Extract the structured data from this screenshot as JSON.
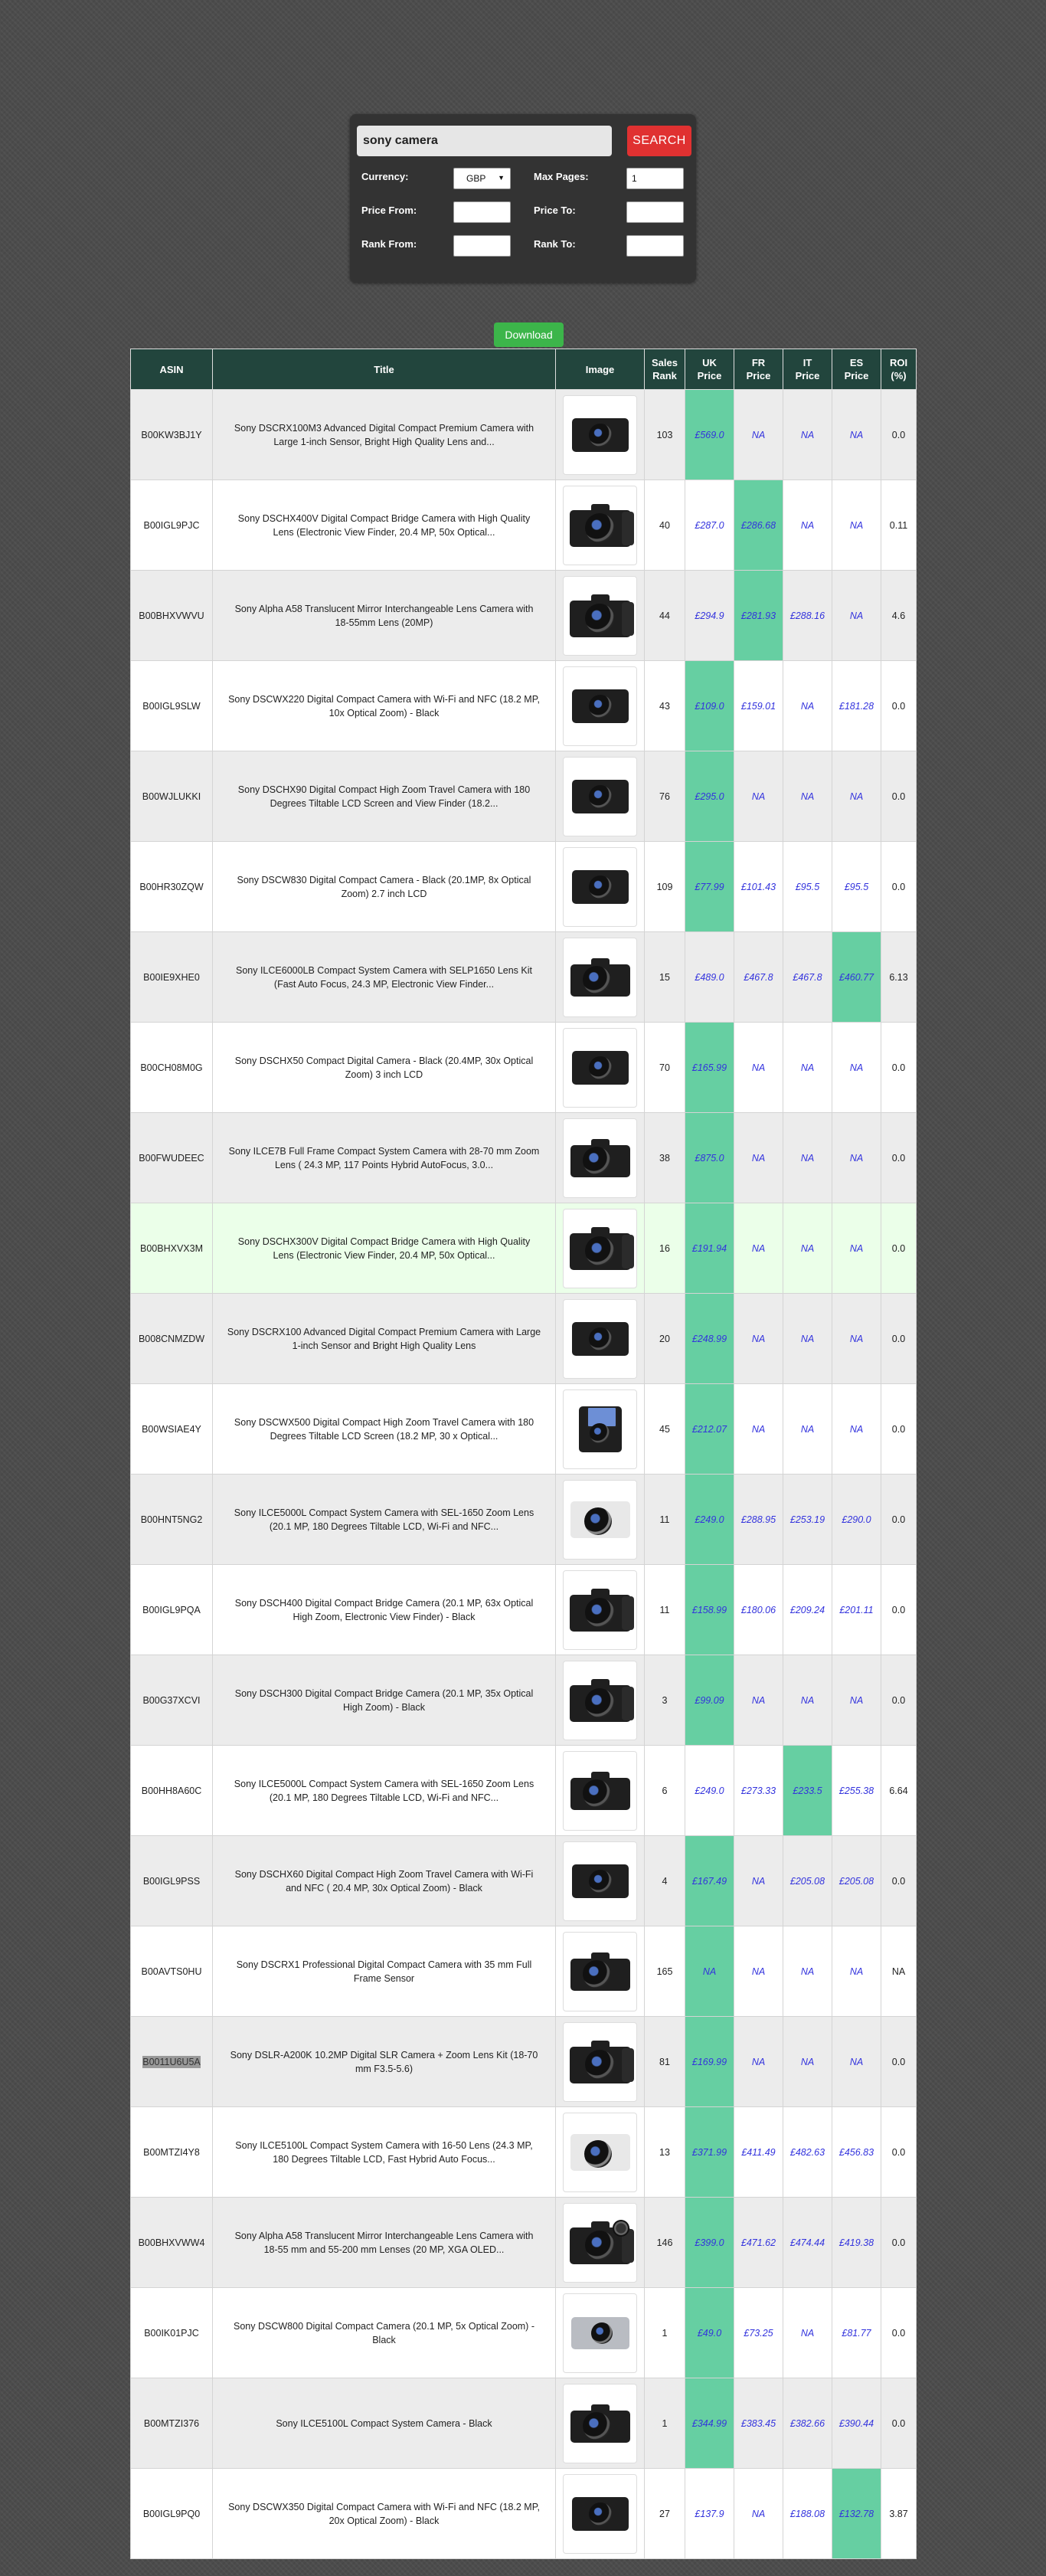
{
  "search": {
    "query": "sony camera",
    "button_label": "SEARCH",
    "currency_label": "Currency:",
    "currency_value": "GBP",
    "max_pages_label": "Max Pages:",
    "max_pages_value": "1",
    "price_from_label": "Price From:",
    "price_from_value": "",
    "price_to_label": "Price To:",
    "price_to_value": "",
    "rank_from_label": "Rank From:",
    "rank_from_value": "",
    "rank_to_label": "Rank To:",
    "rank_to_value": ""
  },
  "download_label": "Download",
  "table": {
    "headers": {
      "asin": "ASIN",
      "title": "Title",
      "image": "Image",
      "sales_rank_1": "Sales",
      "sales_rank_2": "Rank",
      "uk_1": "UK",
      "uk_2": "Price",
      "fr_1": "FR",
      "fr_2": "Price",
      "it_1": "IT",
      "it_2": "Price",
      "es_1": "ES",
      "es_2": "Price",
      "roi_1": "ROI",
      "roi_2": "(%)"
    },
    "highlight_color": "#66cfa2",
    "header_color": "#22453d",
    "rows": [
      {
        "asin": "B00KW3BJ1Y",
        "title": "Sony DSCRX100M3 Advanced Digital Compact Premium Camera with Large 1-inch Sensor, Bright High Quality Lens and...",
        "image": "compact-camera-icon",
        "rank": "103",
        "uk": "£569.0",
        "fr": "NA",
        "it": "NA",
        "es": "NA",
        "roi": "0.0",
        "best": "uk"
      },
      {
        "asin": "B00IGL9PJC",
        "title": "Sony DSCHX400V Digital Compact Bridge Camera with High Quality Lens (Electronic View Finder, 20.4 MP, 50x Optical...",
        "image": "bridge-camera-icon",
        "rank": "40",
        "uk": "£287.0",
        "fr": "£286.68",
        "it": "NA",
        "es": "NA",
        "roi": "0.11",
        "best": "fr"
      },
      {
        "asin": "B00BHXVWVU",
        "title": "Sony Alpha A58 Translucent Mirror Interchangeable Lens Camera with 18-55mm Lens (20MP)",
        "image": "dslr-camera-icon",
        "rank": "44",
        "uk": "£294.9",
        "fr": "£281.93",
        "it": "£288.16",
        "es": "NA",
        "roi": "4.6",
        "best": "fr"
      },
      {
        "asin": "B00IGL9SLW",
        "title": "Sony DSCWX220 Digital Compact Camera with Wi-Fi and NFC (18.2 MP, 10x Optical Zoom) - Black",
        "image": "compact-camera-icon",
        "rank": "43",
        "uk": "£109.0",
        "fr": "£159.01",
        "it": "NA",
        "es": "£181.28",
        "roi": "0.0",
        "best": "uk"
      },
      {
        "asin": "B00WJLUKKI",
        "title": "Sony DSCHX90 Digital Compact High Zoom Travel Camera with 180 Degrees Tiltable LCD Screen and View Finder (18.2...",
        "image": "compact-camera-icon",
        "rank": "76",
        "uk": "£295.0",
        "fr": "NA",
        "it": "NA",
        "es": "NA",
        "roi": "0.0",
        "best": "uk"
      },
      {
        "asin": "B00HR30ZQW",
        "title": "Sony DSCW830 Digital Compact Camera - Black (20.1MP, 8x Optical Zoom) 2.7 inch LCD",
        "image": "compact-camera-icon",
        "rank": "109",
        "uk": "£77.99",
        "fr": "£101.43",
        "it": "£95.5",
        "es": "£95.5",
        "roi": "0.0",
        "best": "uk"
      },
      {
        "asin": "B00IE9XHE0",
        "title": "Sony ILCE6000LB Compact System Camera with SELP1650 Lens Kit (Fast Auto Focus, 24.3 MP, Electronic View Finder...",
        "image": "system-camera-icon",
        "rank": "15",
        "uk": "£489.0",
        "fr": "£467.8",
        "it": "£467.8",
        "es": "£460.77",
        "roi": "6.13",
        "best": "es"
      },
      {
        "asin": "B00CH08M0G",
        "title": "Sony DSCHX50 Compact Digital Camera - Black (20.4MP, 30x Optical Zoom) 3 inch LCD",
        "image": "compact-camera-icon",
        "rank": "70",
        "uk": "£165.99",
        "fr": "NA",
        "it": "NA",
        "es": "NA",
        "roi": "0.0",
        "best": "uk"
      },
      {
        "asin": "B00FWUDEEC",
        "title": "Sony ILCE7B Full Frame Compact System Camera with 28-70 mm Zoom Lens ( 24.3 MP, 117 Points Hybrid AutoFocus, 3.0...",
        "image": "system-camera-icon",
        "rank": "38",
        "uk": "£875.0",
        "fr": "NA",
        "it": "NA",
        "es": "NA",
        "roi": "0.0",
        "best": "uk"
      },
      {
        "asin": "B00BHXVX3M",
        "title": "Sony DSCHX300V Digital Compact Bridge Camera with High Quality Lens (Electronic View Finder, 20.4 MP, 50x Optical...",
        "image": "bridge-camera-icon",
        "rank": "16",
        "uk": "£191.94",
        "fr": "NA",
        "it": "NA",
        "es": "NA",
        "roi": "0.0",
        "best": "uk",
        "highlight_row": true
      },
      {
        "asin": "B008CNMZDW",
        "title": "Sony DSCRX100 Advanced Digital Compact Premium Camera with Large 1-inch Sensor and Bright High Quality Lens",
        "image": "compact-camera-icon",
        "rank": "20",
        "uk": "£248.99",
        "fr": "NA",
        "it": "NA",
        "es": "NA",
        "roi": "0.0",
        "best": "uk"
      },
      {
        "asin": "B00WSIAE4Y",
        "title": "Sony DSCWX500 Digital Compact High Zoom Travel Camera with 180 Degrees Tiltable LCD Screen (18.2 MP, 30 x Optical...",
        "image": "tilt-screen-camera-icon",
        "rank": "45",
        "uk": "£212.07",
        "fr": "NA",
        "it": "NA",
        "es": "NA",
        "roi": "0.0",
        "best": "uk"
      },
      {
        "asin": "B00HNT5NG2",
        "title": "Sony ILCE5000L Compact System Camera with SEL-1650 Zoom Lens (20.1 MP, 180 Degrees Tiltable LCD, Wi-Fi and NFC...",
        "image": "white-system-camera-icon",
        "rank": "11",
        "uk": "£249.0",
        "fr": "£288.95",
        "it": "£253.19",
        "es": "£290.0",
        "roi": "0.0",
        "best": "uk"
      },
      {
        "asin": "B00IGL9PQA",
        "title": "Sony DSCH400 Digital Compact Bridge Camera (20.1 MP, 63x Optical High Zoom, Electronic View Finder) - Black",
        "image": "bridge-camera-icon",
        "rank": "11",
        "uk": "£158.99",
        "fr": "£180.06",
        "it": "£209.24",
        "es": "£201.11",
        "roi": "0.0",
        "best": "uk"
      },
      {
        "asin": "B00G37XCVI",
        "title": "Sony DSCH300 Digital Compact Bridge Camera (20.1 MP, 35x Optical High Zoom) - Black",
        "image": "bridge-camera-icon",
        "rank": "3",
        "uk": "£99.09",
        "fr": "NA",
        "it": "NA",
        "es": "NA",
        "roi": "0.0",
        "best": "uk"
      },
      {
        "asin": "B00HH8A60C",
        "title": "Sony ILCE5000L Compact System Camera with SEL-1650 Zoom Lens (20.1 MP, 180 Degrees Tiltable LCD, Wi-Fi and NFC...",
        "image": "system-camera-icon",
        "rank": "6",
        "uk": "£249.0",
        "fr": "£273.33",
        "it": "£233.5",
        "es": "£255.38",
        "roi": "6.64",
        "best": "it"
      },
      {
        "asin": "B00IGL9PSS",
        "title": "Sony DSCHX60 Digital Compact High Zoom Travel Camera with Wi-Fi and NFC ( 20.4 MP, 30x Optical Zoom) - Black",
        "image": "compact-camera-icon",
        "rank": "4",
        "uk": "£167.49",
        "fr": "NA",
        "it": "£205.08",
        "es": "£205.08",
        "roi": "0.0",
        "best": "uk"
      },
      {
        "asin": "B00AVTS0HU",
        "title": "Sony DSCRX1 Professional Digital Compact Camera with 35 mm Full Frame Sensor",
        "image": "system-camera-icon",
        "rank": "165",
        "uk": "NA",
        "fr": "NA",
        "it": "NA",
        "es": "NA",
        "roi": "NA",
        "best": "uk"
      },
      {
        "asin": "B0011U6U5A",
        "title": "Sony DSLR-A200K 10.2MP Digital SLR Camera + Zoom Lens Kit (18-70 mm F3.5-5.6)",
        "image": "dslr-camera-icon",
        "rank": "81",
        "uk": "£169.99",
        "fr": "NA",
        "it": "NA",
        "es": "NA",
        "roi": "0.0",
        "best": "uk",
        "asin_highlight": true
      },
      {
        "asin": "B00MTZI4Y8",
        "title": "Sony ILCE5100L Compact System Camera with 16-50 Lens (24.3 MP, 180 Degrees Tiltable LCD, Fast Hybrid Auto Focus...",
        "image": "white-system-camera-icon",
        "rank": "13",
        "uk": "£371.99",
        "fr": "£411.49",
        "it": "£482.63",
        "es": "£456.83",
        "roi": "0.0",
        "best": "uk"
      },
      {
        "asin": "B00BHXVWW4",
        "title": "Sony Alpha A58 Translucent Mirror Interchangeable Lens Camera with 18-55 mm and 55-200 mm Lenses (20 MP, XGA OLED...",
        "image": "dslr-kit-icon",
        "rank": "146",
        "uk": "£399.0",
        "fr": "£471.62",
        "it": "£474.44",
        "es": "£419.38",
        "roi": "0.0",
        "best": "uk"
      },
      {
        "asin": "B00IK01PJC",
        "title": "Sony DSCW800 Digital Compact Camera (20.1 MP, 5x Optical Zoom) - Black",
        "image": "silver-compact-camera-icon",
        "rank": "1",
        "uk": "£49.0",
        "fr": "£73.25",
        "it": "NA",
        "es": "£81.77",
        "roi": "0.0",
        "best": "uk"
      },
      {
        "asin": "B00MTZI376",
        "title": "Sony ILCE5100L Compact System Camera - Black",
        "image": "system-camera-icon",
        "rank": "1",
        "uk": "£344.99",
        "fr": "£383.45",
        "it": "£382.66",
        "es": "£390.44",
        "roi": "0.0",
        "best": "uk"
      },
      {
        "asin": "B00IGL9PQ0",
        "title": "Sony DSCWX350 Digital Compact Camera with Wi-Fi and NFC (18.2 MP, 20x Optical Zoom) - Black",
        "image": "compact-camera-icon",
        "rank": "27",
        "uk": "£137.9",
        "fr": "NA",
        "it": "£188.08",
        "es": "£132.78",
        "roi": "3.87",
        "best": "es"
      }
    ]
  }
}
